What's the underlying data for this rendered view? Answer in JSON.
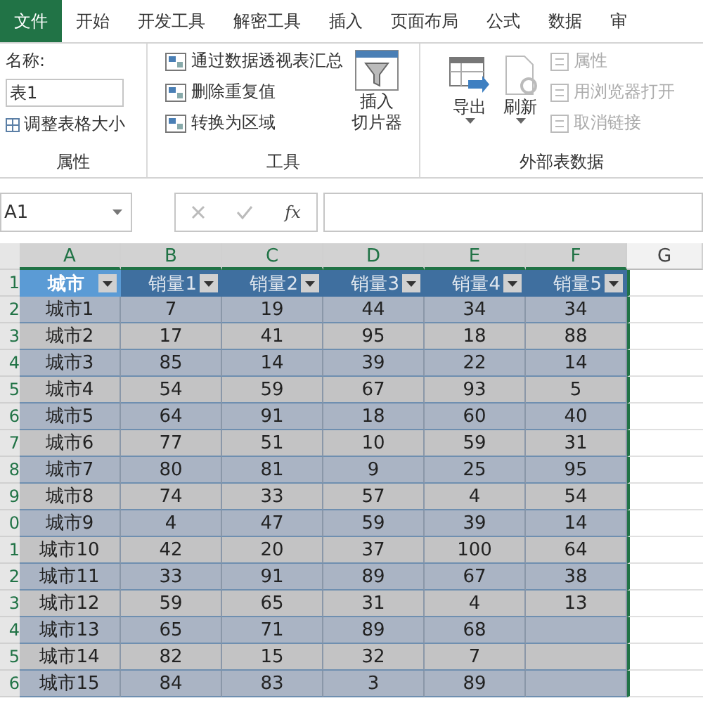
{
  "tabs": [
    {
      "label": "文件",
      "selected": true
    },
    {
      "label": "开始",
      "selected": false
    },
    {
      "label": "开发工具",
      "selected": false
    },
    {
      "label": "解密工具",
      "selected": false
    },
    {
      "label": "插入",
      "selected": false
    },
    {
      "label": "页面布局",
      "selected": false
    },
    {
      "label": "公式",
      "selected": false
    },
    {
      "label": "数据",
      "selected": false
    },
    {
      "label": "审",
      "selected": false
    }
  ],
  "ribbon": {
    "properties": {
      "name_label": "名称:",
      "name_value": "表1",
      "resize": "调整表格大小",
      "group_label": "属性"
    },
    "tools": {
      "items": [
        {
          "label": "通过数据透视表汇总"
        },
        {
          "label": "删除重复值"
        },
        {
          "label": "转换为区域"
        }
      ],
      "slicer": [
        "插入",
        "切片器"
      ],
      "group_label": "工具"
    },
    "external": {
      "buttons": [
        {
          "label": "导出"
        },
        {
          "label": "刷新"
        }
      ],
      "items": [
        {
          "label": "属性",
          "disabled": true
        },
        {
          "label": "用浏览器打开",
          "disabled": true
        },
        {
          "label": "取消链接",
          "disabled": true
        }
      ],
      "group_label": "外部表数据"
    }
  },
  "formula_bar": {
    "name_box": "A1",
    "fx": "fx"
  },
  "columns": [
    {
      "label": "A",
      "selected": true
    },
    {
      "label": "B",
      "selected": true
    },
    {
      "label": "C",
      "selected": true
    },
    {
      "label": "D",
      "selected": true
    },
    {
      "label": "E",
      "selected": true
    },
    {
      "label": "F",
      "selected": true
    },
    {
      "label": "G",
      "selected": false
    }
  ],
  "table": {
    "row_number": "1",
    "headers": [
      {
        "label": "城市",
        "selected": true
      },
      {
        "label": "销量1",
        "selected": false
      },
      {
        "label": "销量2",
        "selected": false
      },
      {
        "label": "销量3",
        "selected": false
      },
      {
        "label": "销量4",
        "selected": false
      },
      {
        "label": "销量5",
        "selected": false
      }
    ],
    "rows": [
      {
        "row_number": "2",
        "cells": [
          "城市1",
          "7",
          "19",
          "44",
          "34",
          "34"
        ]
      },
      {
        "row_number": "3",
        "cells": [
          "城市2",
          "17",
          "41",
          "95",
          "18",
          "88"
        ]
      },
      {
        "row_number": "4",
        "cells": [
          "城市3",
          "85",
          "14",
          "39",
          "22",
          "14"
        ]
      },
      {
        "row_number": "5",
        "cells": [
          "城市4",
          "54",
          "59",
          "67",
          "93",
          "5"
        ]
      },
      {
        "row_number": "6",
        "cells": [
          "城市5",
          "64",
          "91",
          "18",
          "60",
          "40"
        ]
      },
      {
        "row_number": "7",
        "cells": [
          "城市6",
          "77",
          "51",
          "10",
          "59",
          "31"
        ]
      },
      {
        "row_number": "8",
        "cells": [
          "城市7",
          "80",
          "81",
          "9",
          "25",
          "95"
        ]
      },
      {
        "row_number": "9",
        "cells": [
          "城市8",
          "74",
          "33",
          "57",
          "4",
          "54"
        ]
      },
      {
        "row_number": "0",
        "cells": [
          "城市9",
          "4",
          "47",
          "59",
          "39",
          "14"
        ]
      },
      {
        "row_number": "1",
        "cells": [
          "城市10",
          "42",
          "20",
          "37",
          "100",
          "64"
        ]
      },
      {
        "row_number": "2",
        "cells": [
          "城市11",
          "33",
          "91",
          "89",
          "67",
          "38"
        ]
      },
      {
        "row_number": "3",
        "cells": [
          "城市12",
          "59",
          "65",
          "31",
          "4",
          "13"
        ]
      },
      {
        "row_number": "4",
        "cells": [
          "城市13",
          "65",
          "71",
          "89",
          "68"
        ]
      },
      {
        "row_number": "5",
        "cells": [
          "城市14",
          "82",
          "15",
          "32",
          "7"
        ]
      },
      {
        "row_number": "6",
        "cells": [
          "城市15",
          "84",
          "83",
          "3",
          "89"
        ]
      }
    ]
  }
}
